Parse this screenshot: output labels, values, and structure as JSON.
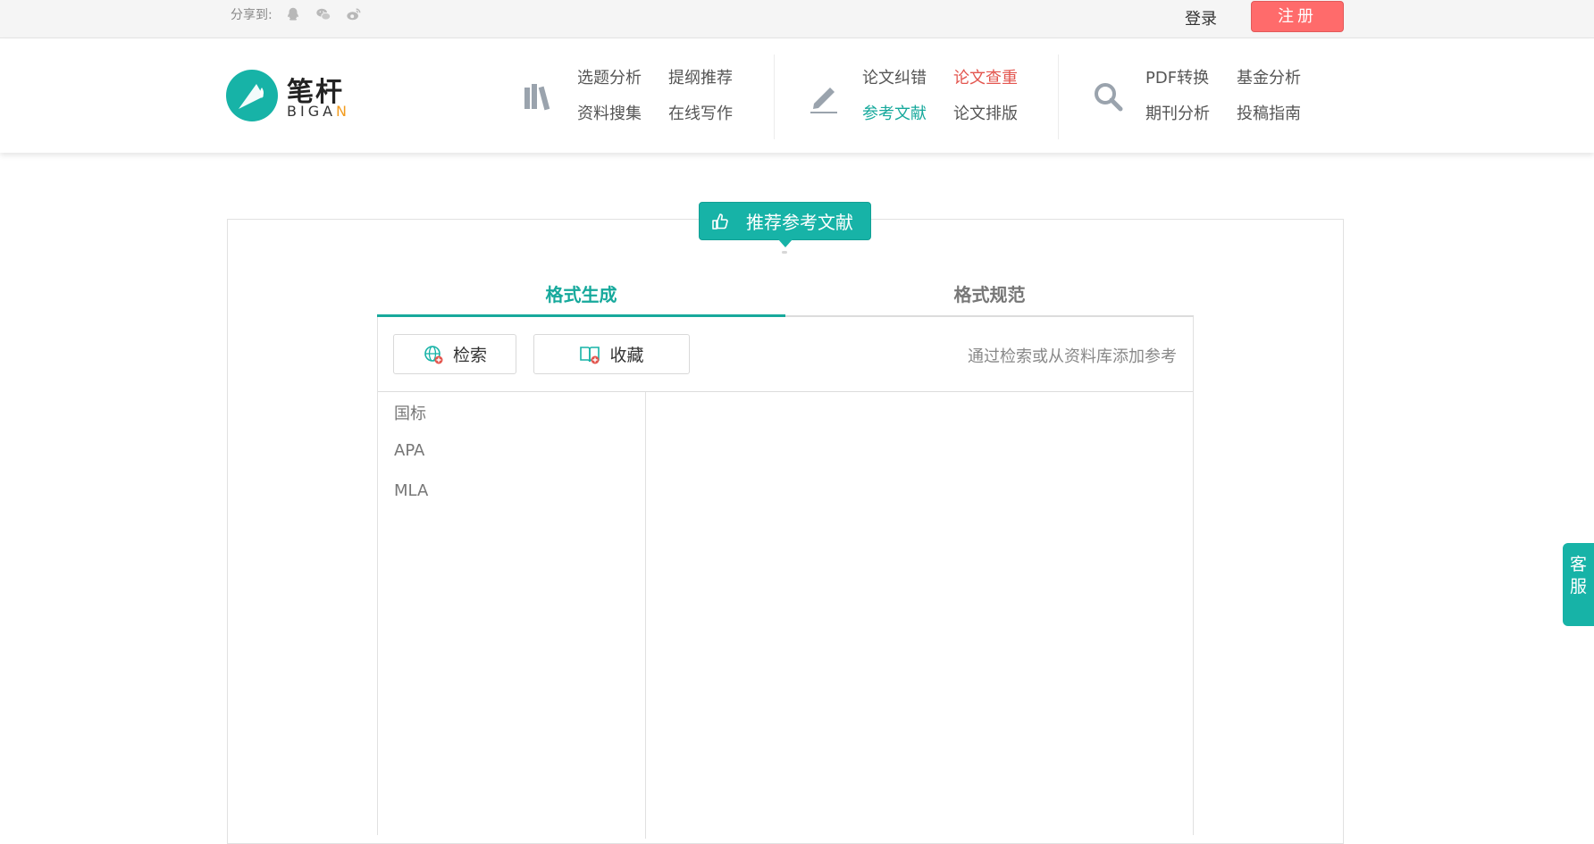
{
  "topbar": {
    "share_label": "分享到:",
    "share_icons": [
      "qq-icon",
      "wechat-icon",
      "weibo-icon"
    ],
    "login_label": "登录",
    "register_label": "注册"
  },
  "logo": {
    "name": "笔杆",
    "sub_main": "BIGA",
    "sub_accent": "N"
  },
  "nav": {
    "groups": [
      {
        "icon": "books-icon",
        "links": [
          "选题分析",
          "提纲推荐",
          "资料搜集",
          "在线写作"
        ]
      },
      {
        "icon": "pen-icon",
        "links": [
          "论文纠错",
          "论文查重",
          "参考文献",
          "论文排版"
        ]
      },
      {
        "icon": "search-icon",
        "links": [
          "PDF转换",
          "基金分析",
          "期刊分析",
          "投稿指南"
        ]
      }
    ]
  },
  "badge": {
    "label": "推荐参考文献"
  },
  "tabs": [
    {
      "label": "格式生成"
    },
    {
      "label": "格式规范"
    }
  ],
  "toolbar": {
    "search_label": "检索",
    "favorites_label": "收藏",
    "hint": "通过检索或从资料库添加参考"
  },
  "formats": [
    "国标",
    "APA",
    "MLA"
  ],
  "service": {
    "label_1": "客",
    "label_2": "服"
  },
  "colors": {
    "accent": "#17b3a7",
    "register": "#ff6b6b",
    "highlight_red": "#e3564f"
  }
}
